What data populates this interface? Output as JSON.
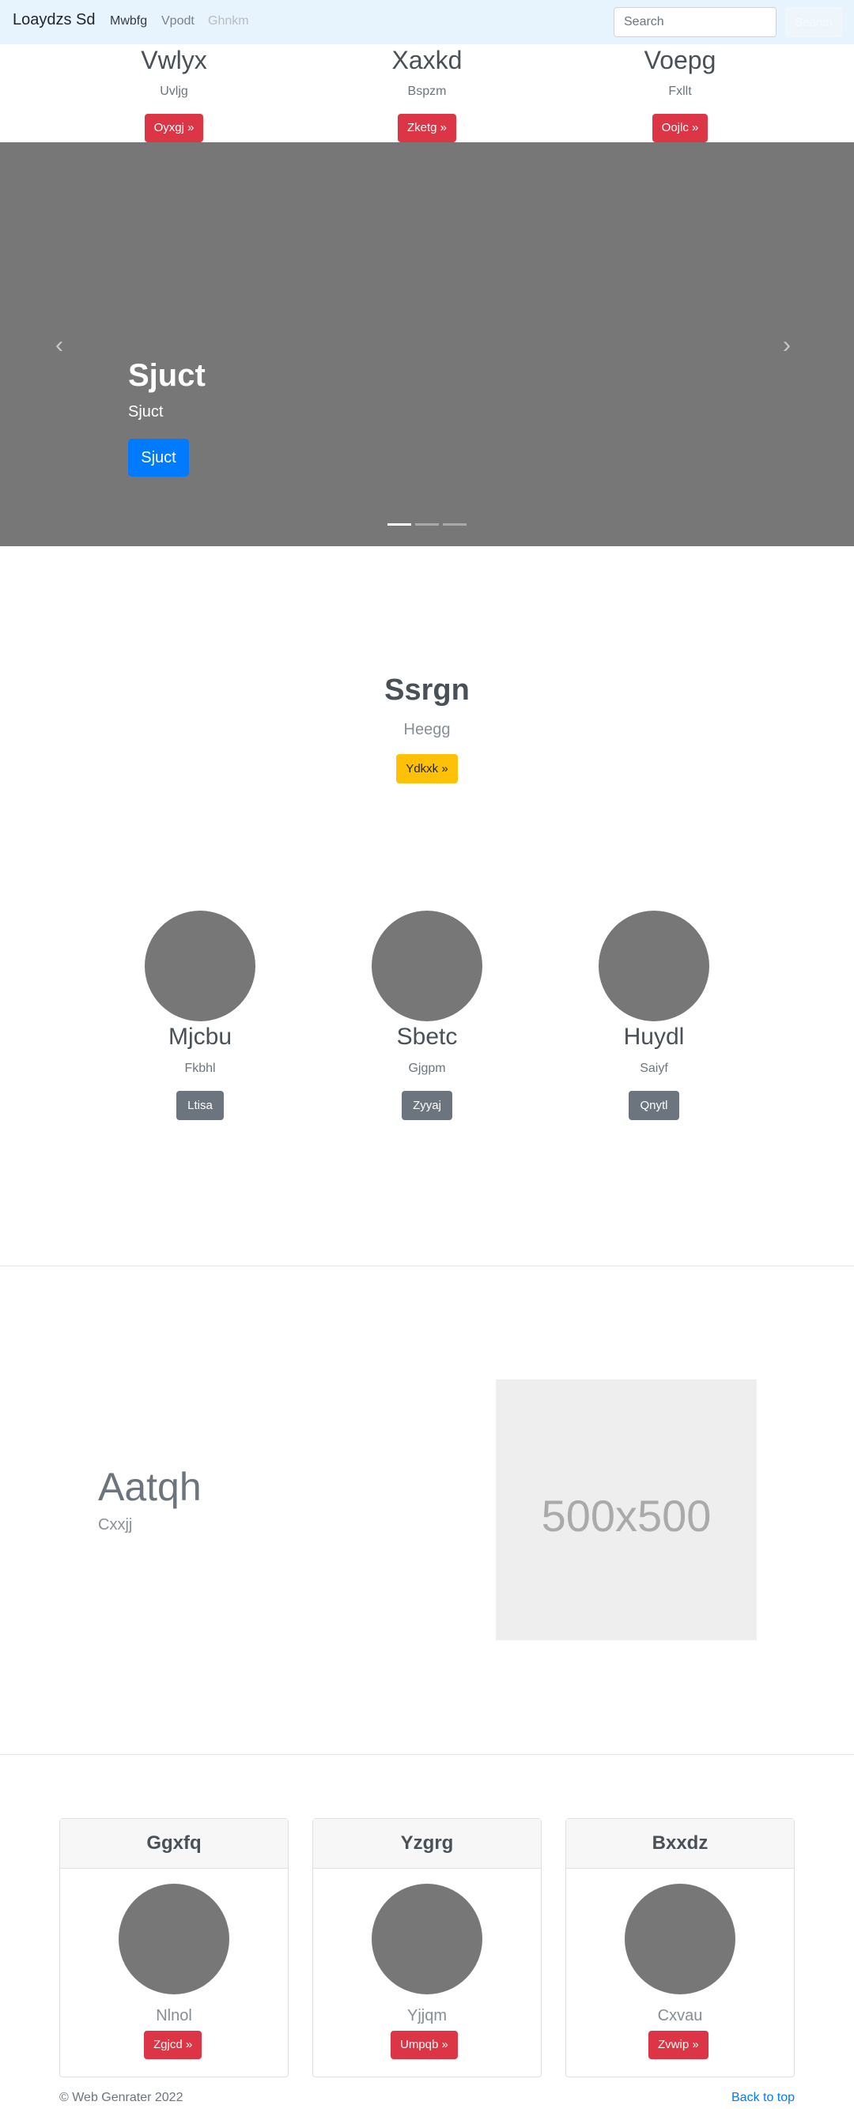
{
  "navbar": {
    "brand": "Loaydzs Sd",
    "links": [
      "Mwbfg",
      "Vpodt",
      "Ghnkm"
    ],
    "search_placeholder": "Search",
    "search_button": "Search"
  },
  "top_columns": [
    {
      "title": "Vwlyx",
      "text": "Uvljg",
      "button": "Oyxgj »"
    },
    {
      "title": "Xaxkd",
      "text": "Bspzm",
      "button": "Zketg »"
    },
    {
      "title": "Voepg",
      "text": "Fxllt",
      "button": "Oojlc »"
    }
  ],
  "carousel": {
    "title": "Sjuct",
    "text": "Sjuct",
    "button": "Sjuct",
    "prev_icon": "‹",
    "next_icon": "›",
    "indicator_count": 3,
    "active_indicator": 1
  },
  "jumbotron": {
    "title": "Ssrgn",
    "subtitle": "Heegg",
    "button": "Ydkxk »"
  },
  "circle_columns": [
    {
      "title": "Mjcbu",
      "text": "Fkbhl",
      "button": "Ltisa"
    },
    {
      "title": "Sbetc",
      "text": "Gjgpm",
      "button": "Zyyaj"
    },
    {
      "title": "Huydl",
      "text": "Saiyf",
      "button": "Qnytl"
    }
  ],
  "featurette": {
    "title": "Aatqh",
    "subtitle": "Cxxjj",
    "placeholder_text": "500x500"
  },
  "cards": [
    {
      "header": "Ggxfq",
      "text": "Nlnol",
      "button": "Zgjcd »"
    },
    {
      "header": "Yzgrg",
      "text": "Yjjqm",
      "button": "Umpqb »"
    },
    {
      "header": "Bxxdz",
      "text": "Cxvau",
      "button": "Zvwip »"
    }
  ],
  "footer": {
    "copyright": "© Web Genrater 2022",
    "back_to_top": "Back to top"
  },
  "colors": {
    "navbar_bg": "#e8f4fd",
    "danger": "#dc3545",
    "primary": "#007bff",
    "warning": "#ffc107",
    "secondary": "#6c757d",
    "placeholder_gray": "#777777"
  }
}
